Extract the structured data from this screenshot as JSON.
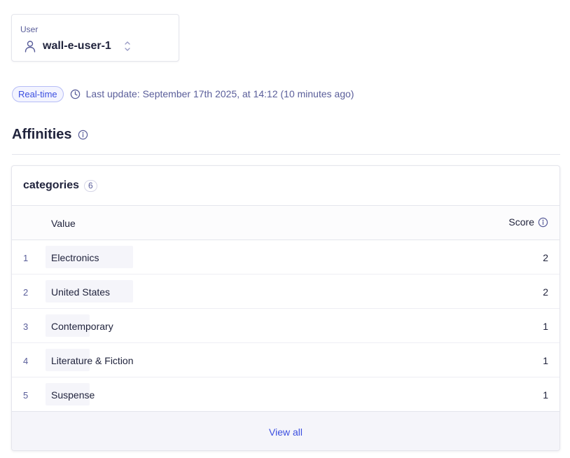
{
  "user_selector": {
    "label": "User",
    "value": "wall-e-user-1",
    "icon": "person-icon",
    "chevron_icon": "chevron-up-down-icon"
  },
  "status": {
    "badge": "Real-time",
    "icon": "clock-icon",
    "last_update": "Last update: September 17th 2025, at 14:12 (10 minutes ago)"
  },
  "section": {
    "title": "Affinities",
    "icon": "info-icon"
  },
  "panel": {
    "title": "categories",
    "count": "6",
    "columns": {
      "value": "Value",
      "score": "Score"
    },
    "rows": [
      {
        "rank": "1",
        "value": "Electronics",
        "score": "2",
        "relative_score": 1.0
      },
      {
        "rank": "2",
        "value": "United States",
        "score": "2",
        "relative_score": 1.0
      },
      {
        "rank": "3",
        "value": "Contemporary",
        "score": "1",
        "relative_score": 0.5
      },
      {
        "rank": "4",
        "value": "Literature & Fiction",
        "score": "1",
        "relative_score": 0.5
      },
      {
        "rank": "5",
        "value": "Suspense",
        "score": "1",
        "relative_score": 0.5
      }
    ],
    "footer_link": "View all"
  },
  "colors": {
    "accent": "#3c4fe0",
    "text": "#21243d",
    "muted": "#5a5e9a"
  }
}
